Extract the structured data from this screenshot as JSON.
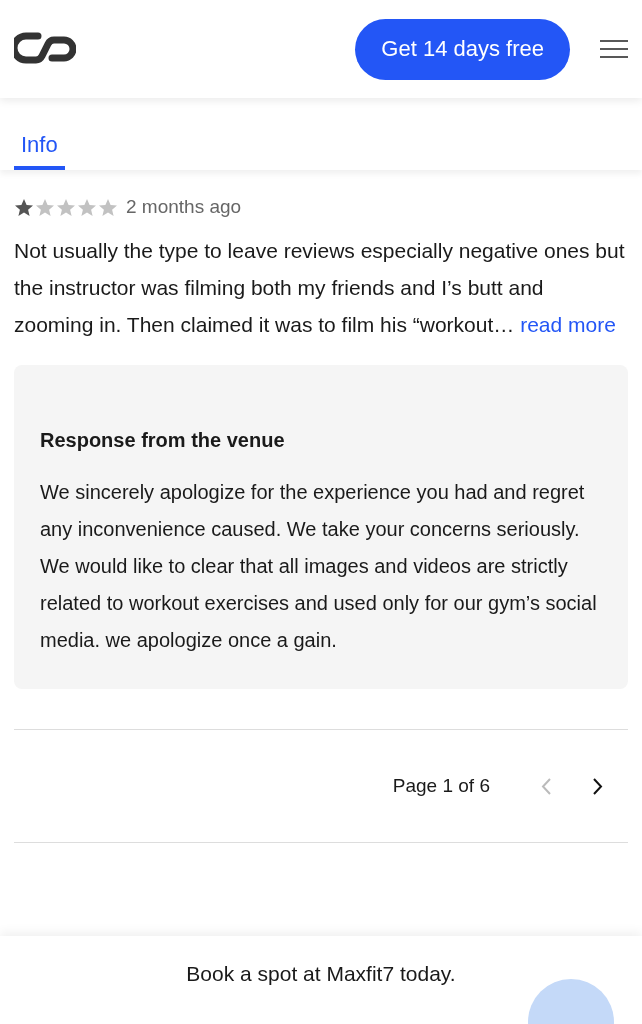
{
  "header": {
    "cta": "Get 14 days free"
  },
  "tabs": [
    {
      "label": "Info",
      "selected": true
    }
  ],
  "review": {
    "stars": 1,
    "time": "2 months ago",
    "text": "Not usually the type to leave reviews especially negative ones but the instructor was filming both my friends and I’s butt and zooming in. Then claimed it was to film his “workout…",
    "more": "read more",
    "response": {
      "heading": "Response from the venue",
      "text": "We sincerely apologize for the experience you had and regret any inconvenience caused. We take your concerns seriously. We would like to clear that all images and videos are strictly related to workout exercises and used only for our gym’s social media. we apologize once a gain."
    }
  },
  "pagination": {
    "label": "Page 1 of 6",
    "prev": {
      "disabled": true
    },
    "next": {
      "disabled": false
    }
  },
  "booking": {
    "text": "Book a spot at Maxfit7 today."
  }
}
